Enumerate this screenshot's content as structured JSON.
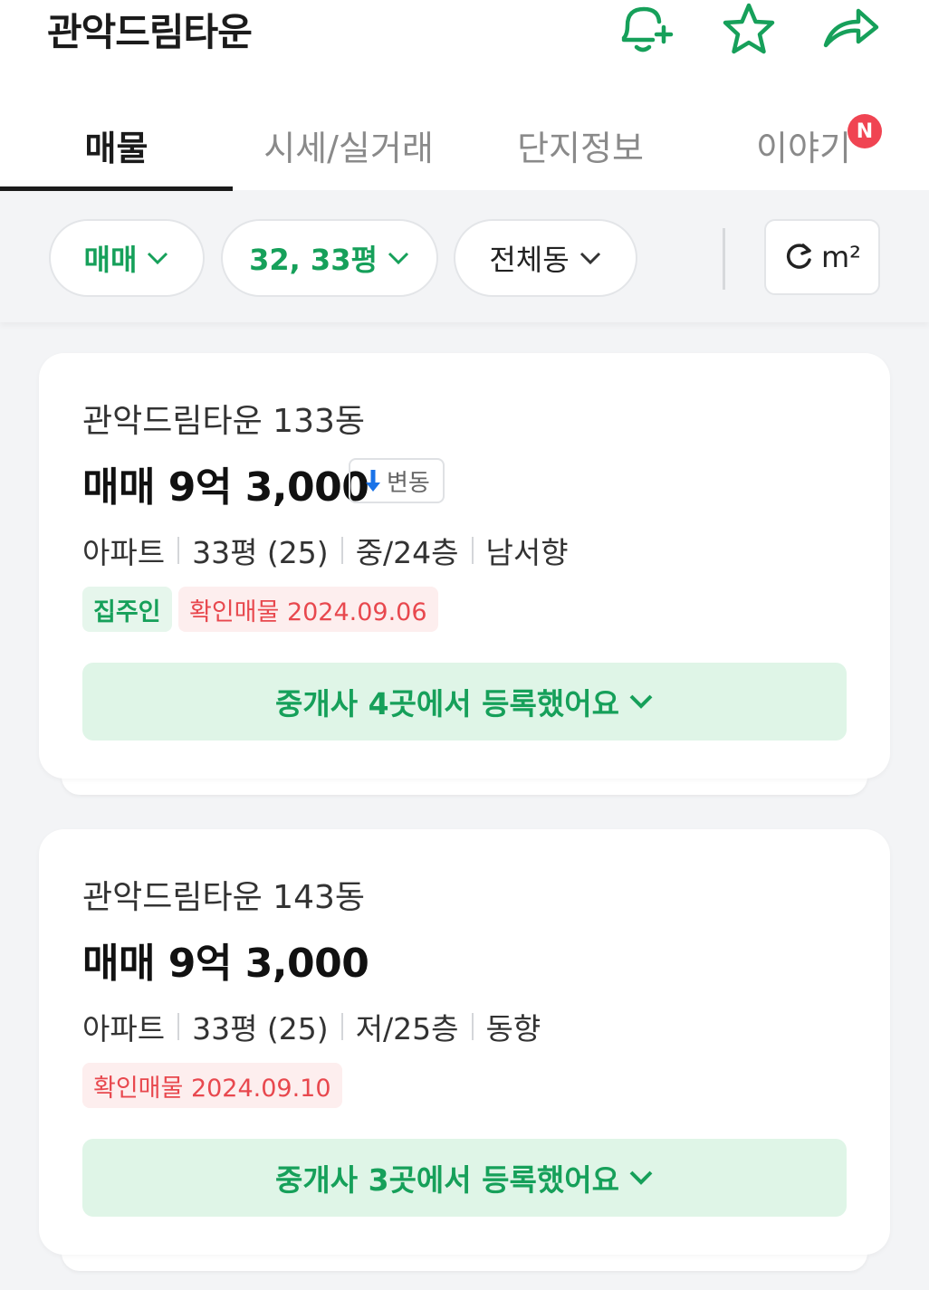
{
  "header": {
    "title": "관악드림타운",
    "icons": [
      "bell-plus-icon",
      "star-icon",
      "share-icon"
    ],
    "accent": "#16a05a"
  },
  "tabs": [
    {
      "label": "매물",
      "active": true
    },
    {
      "label": "시세/실거래",
      "active": false
    },
    {
      "label": "단지정보",
      "active": false
    },
    {
      "label": "이야기",
      "active": false,
      "badge": "N"
    }
  ],
  "filters": {
    "trade_type": "매매",
    "area": "32, 33평",
    "dong": "전체동",
    "unit": "m²"
  },
  "listings": [
    {
      "name": "관악드림타운 133동",
      "price": "매매 9억 3,000",
      "change_label": "변동",
      "info": [
        "아파트",
        "33평 (25)",
        "중/24층",
        "남서향"
      ],
      "owner_tag": "집주인",
      "verified": "확인매물 2024.09.06",
      "agents": "중개사 4곳에서 등록했어요"
    },
    {
      "name": "관악드림타운 143동",
      "price": "매매 9억 3,000",
      "info": [
        "아파트",
        "33평 (25)",
        "저/25층",
        "동향"
      ],
      "verified": "확인매물 2024.09.10",
      "agents": "중개사 3곳에서 등록했어요"
    }
  ]
}
